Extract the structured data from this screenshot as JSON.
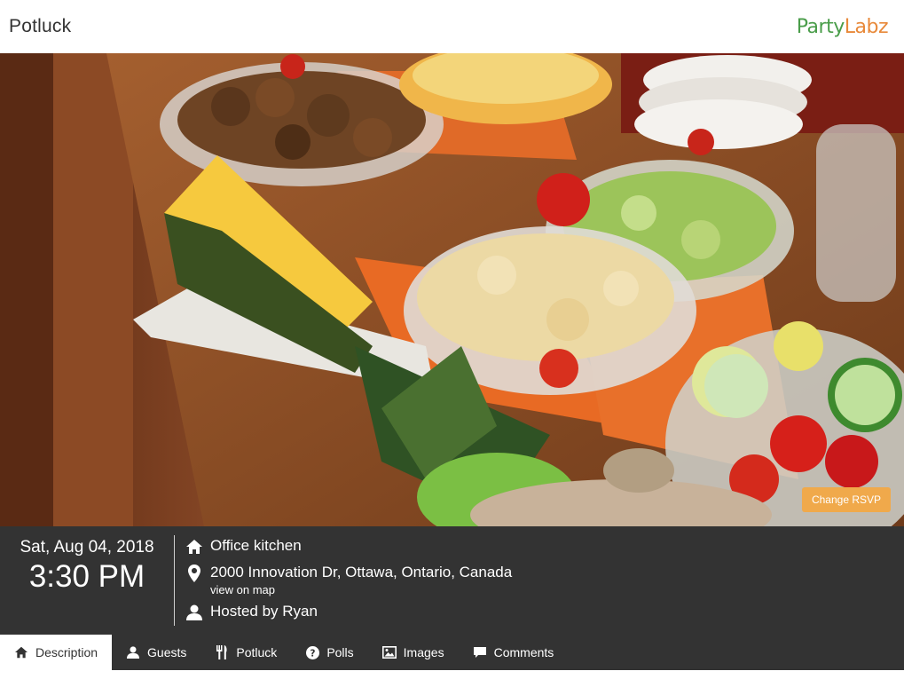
{
  "header": {
    "title": "Potluck",
    "logo_part1": "Party",
    "logo_part2": "Labz",
    "logo_colors": {
      "party": "#4a9d4a",
      "labz": "#e8893a"
    }
  },
  "hero": {
    "rsvp_label": "Change RSVP",
    "rsvp_color": "#f0a94b"
  },
  "event": {
    "date": "Sat, Aug 04, 2018",
    "time": "3:30 PM",
    "location_name": "Office kitchen",
    "address": "2000 Innovation Dr, Ottawa, Ontario, Canada",
    "map_link": "view on map",
    "host": "Hosted by Ryan"
  },
  "tabs": [
    {
      "label": "Description",
      "icon": "home-icon",
      "active": true
    },
    {
      "label": "Guests",
      "icon": "user-icon"
    },
    {
      "label": "Potluck",
      "icon": "utensils-icon"
    },
    {
      "label": "Polls",
      "icon": "question-circle-icon"
    },
    {
      "label": "Images",
      "icon": "image-icon"
    },
    {
      "label": "Comments",
      "icon": "comment-icon"
    }
  ],
  "colors": {
    "info_bar": "#333333",
    "text": "#ffffff"
  }
}
